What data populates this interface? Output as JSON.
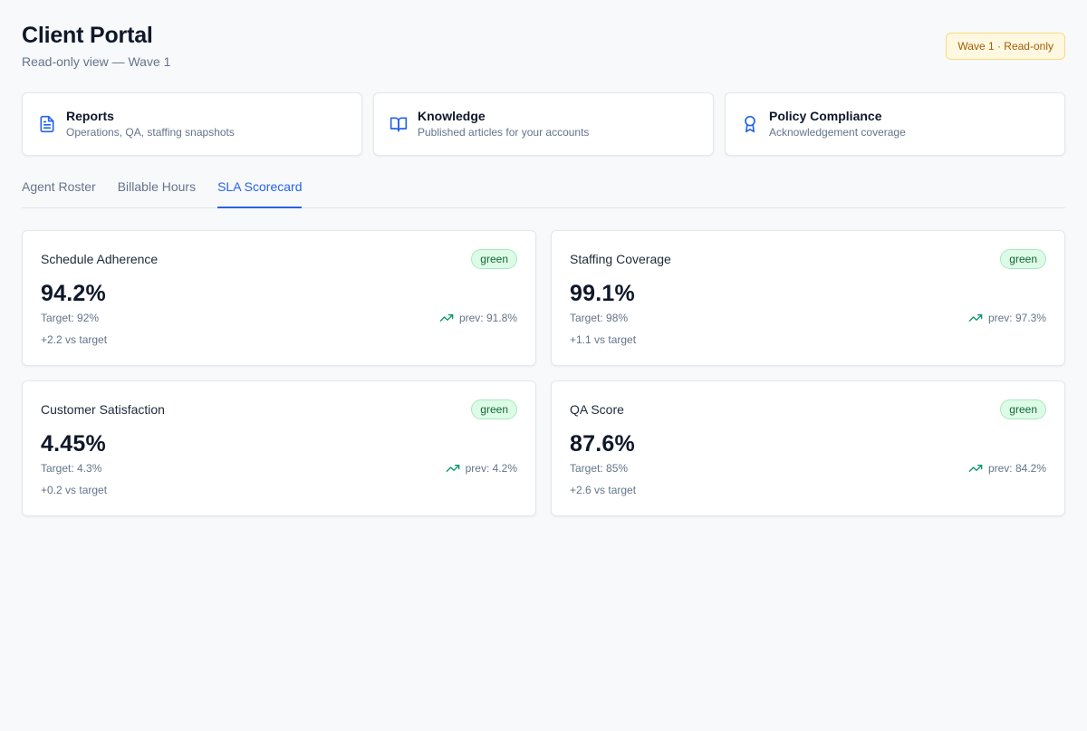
{
  "header": {
    "title": "Client Portal",
    "subtitle": "Read-only view — Wave 1",
    "badge": "Wave 1 · Read-only"
  },
  "quicklinks": [
    {
      "icon": "document-icon",
      "title": "Reports",
      "description": "Operations, QA, staffing snapshots"
    },
    {
      "icon": "book-open-icon",
      "title": "Knowledge",
      "description": "Published articles for your accounts"
    },
    {
      "icon": "award-icon",
      "title": "Policy Compliance",
      "description": "Acknowledgement coverage"
    }
  ],
  "tabs": [
    {
      "label": "Agent Roster",
      "active": false
    },
    {
      "label": "Billable Hours",
      "active": false
    },
    {
      "label": "SLA Scorecard",
      "active": true
    }
  ],
  "metrics": [
    {
      "title": "Schedule Adherence",
      "status": "green",
      "value": "94.2%",
      "target": "Target: 92%",
      "delta": "+2.2 vs target",
      "prev": "prev: 91.8%",
      "trend_icon": "trending-up-icon"
    },
    {
      "title": "Staffing Coverage",
      "status": "green",
      "value": "99.1%",
      "target": "Target: 98%",
      "delta": "+1.1 vs target",
      "prev": "prev: 97.3%",
      "trend_icon": "trending-up-icon"
    },
    {
      "title": "Customer Satisfaction",
      "status": "green",
      "value": "4.45%",
      "target": "Target: 4.3%",
      "delta": "+0.2 vs target",
      "prev": "prev: 4.2%",
      "trend_icon": "trending-up-icon"
    },
    {
      "title": "QA Score",
      "status": "green",
      "value": "87.6%",
      "target": "Target: 85%",
      "delta": "+2.6 vs target",
      "prev": "prev: 84.2%",
      "trend_icon": "trending-up-icon"
    }
  ],
  "colors": {
    "accent": "#2563eb",
    "status_green_bg": "#dcfce7",
    "status_green_text": "#166534",
    "trend_up": "#059669",
    "badge_bg": "#fff8e1",
    "badge_text": "#a15c07"
  }
}
